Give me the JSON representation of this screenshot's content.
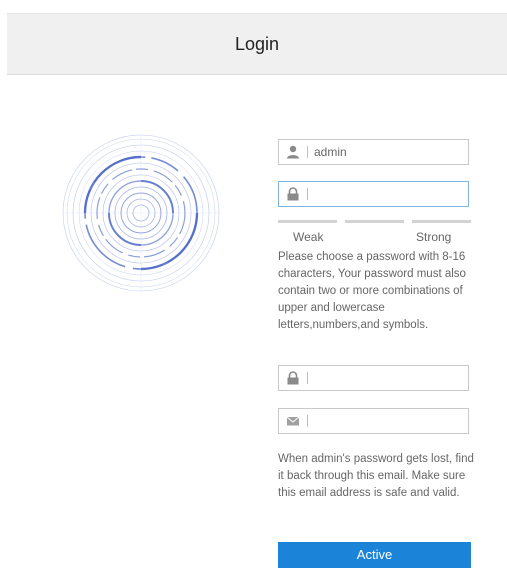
{
  "header": {
    "title": "Login"
  },
  "form": {
    "username": {
      "value": "admin",
      "icon": "user-icon"
    },
    "password": {
      "value": "",
      "icon": "lock-icon"
    },
    "strength": {
      "weak_label": "Weak",
      "strong_label": "Strong"
    },
    "password_hint": "Please choose a password with 8-16 characters, Your password must also contain two or more combinations of upper and lowercase letters,numbers,and symbols.",
    "confirm_password": {
      "value": "",
      "icon": "lock-icon"
    },
    "email": {
      "value": "",
      "icon": "envelope-icon"
    },
    "email_hint": "When admin's password gets lost, find it back through this email. Make sure this email address is safe and valid.",
    "submit_label": "Active"
  },
  "colors": {
    "accent": "#1c84d8",
    "logo": "#6f86d4"
  }
}
